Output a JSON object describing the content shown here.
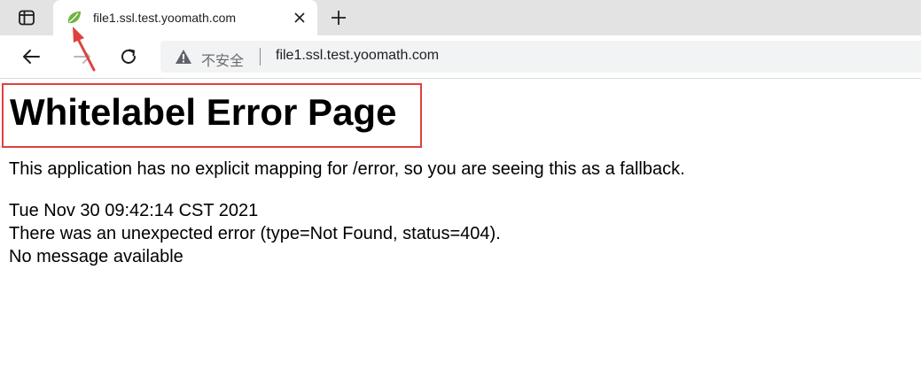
{
  "tab": {
    "title": "file1.ssl.test.yoomath.com"
  },
  "address_bar": {
    "security_label": "不安全",
    "url": "file1.ssl.test.yoomath.com"
  },
  "page": {
    "title": "Whitelabel Error Page",
    "description": "This application has no explicit mapping for /error, so you are seeing this as a fallback.",
    "timestamp": "Tue Nov 30 09:42:14 CST 2021",
    "error": "There was an unexpected error (type=Not Found, status=404).",
    "message": "No message available"
  },
  "icons": {
    "tab_actions": "tab-actions-icon",
    "favicon": "spring-leaf-icon",
    "tab_close": "close-icon",
    "new_tab": "plus-icon",
    "back": "arrow-left-icon",
    "forward": "arrow-right-icon",
    "reload": "reload-icon",
    "security": "warning-triangle-icon"
  },
  "colors": {
    "annotation": "#e0413e",
    "favicon": "#6db33f",
    "tabstrip_bg": "#e3e3e3",
    "omnibox_bg": "#f1f3f4"
  }
}
